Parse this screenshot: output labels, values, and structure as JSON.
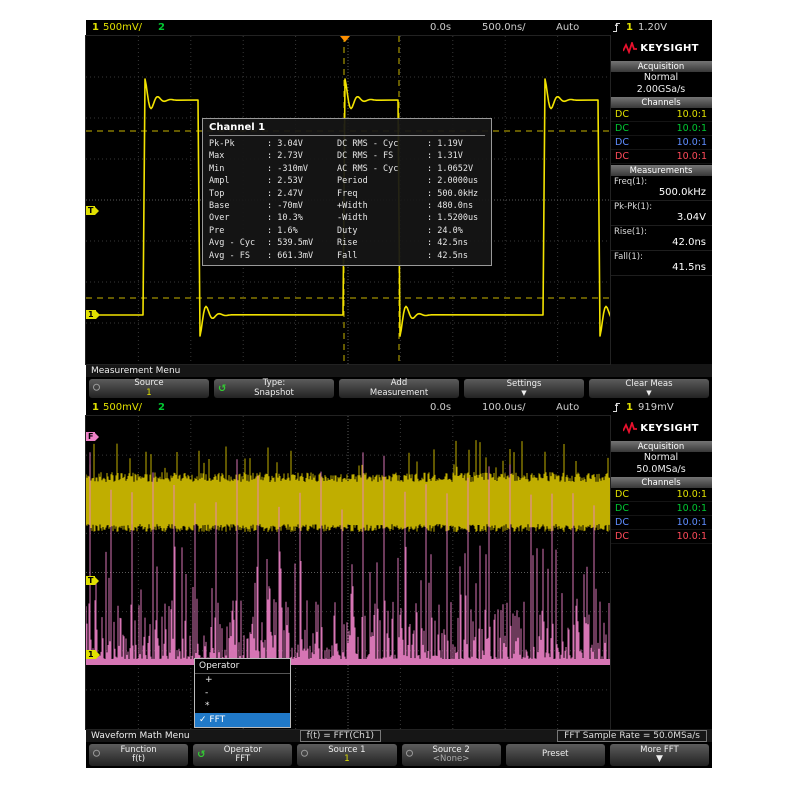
{
  "glyphs": {
    "cycle": "↺",
    "down": "▼",
    "check": "✓"
  },
  "brand": {
    "name": "KEYSIGHT",
    "accent": "#e8112d"
  },
  "scope1": {
    "status": {
      "ch1": "1",
      "ch1_scale": "500mV/",
      "ch2": "2",
      "offset": "0.0s",
      "timebase": "500.0ns/",
      "mode": "Auto",
      "trig_source": "1",
      "trig_level": "1.20V"
    },
    "sidebar": {
      "acq_title": "Acquisition",
      "acq_mode": "Normal",
      "acq_rate": "2.00GSa/s",
      "ch_title": "Channels",
      "channels": [
        {
          "coupling": "DC",
          "probe": "10.0:1",
          "color": "#e0e000"
        },
        {
          "coupling": "DC",
          "probe": "10.0:1",
          "color": "#00c832"
        },
        {
          "coupling": "DC",
          "probe": "10.0:1",
          "color": "#5f8dff"
        },
        {
          "coupling": "DC",
          "probe": "10.0:1",
          "color": "#ff4a5a"
        }
      ],
      "meas_title": "Measurements",
      "measurements": [
        {
          "label": "Freq(1):",
          "value": "500.0kHz"
        },
        {
          "label": "Pk-Pk(1):",
          "value": "3.04V"
        },
        {
          "label": "Rise(1):",
          "value": "42.0ns"
        },
        {
          "label": "Fall(1):",
          "value": "41.5ns"
        }
      ]
    },
    "markers": {
      "trig_level": "T",
      "ground": "1"
    },
    "popup": {
      "title": "Channel 1",
      "rows": [
        {
          "l": "Pk-Pk",
          "lv": ": 3.04V",
          "r": "DC RMS - Cyc",
          "rv": ": 1.19V"
        },
        {
          "l": "Max",
          "lv": ": 2.73V",
          "r": "DC RMS - FS",
          "rv": ": 1.31V"
        },
        {
          "l": "Min",
          "lv": ": -310mV",
          "r": "AC RMS - Cyc",
          "rv": ": 1.0652V"
        },
        {
          "l": "Ampl",
          "lv": ": 2.53V",
          "r": "Period",
          "rv": ": 2.0000us"
        },
        {
          "l": "Top",
          "lv": ": 2.47V",
          "r": "Freq",
          "rv": ": 500.0kHz"
        },
        {
          "l": "Base",
          "lv": ": -70mV",
          "r": "+Width",
          "rv": ": 480.0ns"
        },
        {
          "l": "Over",
          "lv": ": 10.3%",
          "r": "-Width",
          "rv": ": 1.5200us"
        },
        {
          "l": "Pre",
          "lv": ": 1.6%",
          "r": "Duty",
          "rv": ": 24.0%"
        },
        {
          "l": "Avg - Cyc",
          "lv": ": 539.5mV",
          "r": "Rise",
          "rv": ": 42.5ns"
        },
        {
          "l": "Avg - FS",
          "lv": ": 661.3mV",
          "r": "Fall",
          "rv": ": 42.5ns"
        }
      ]
    },
    "menu_label": "Measurement Menu",
    "softkeys": [
      {
        "line1": "Source",
        "line2": "1",
        "icon": "select-circle"
      },
      {
        "line1": "Type:",
        "line2": "Snapshot",
        "icon": "cycle-arrow"
      },
      {
        "line1": "Add",
        "line2": "Measurement",
        "icon": ""
      },
      {
        "line1": "Settings",
        "line2": "",
        "icon": "down-arrow"
      },
      {
        "line1": "Clear Meas",
        "line2": "",
        "icon": "down-arrow"
      }
    ]
  },
  "scope2": {
    "status": {
      "ch1": "1",
      "ch1_scale": "500mV/",
      "ch2": "2",
      "offset": "0.0s",
      "timebase": "100.0us/",
      "mode": "Auto",
      "trig_source": "1",
      "trig_level": "919mV"
    },
    "sidebar": {
      "acq_title": "Acquisition",
      "acq_mode": "Normal",
      "acq_rate": "50.0MSa/s",
      "ch_title": "Channels",
      "channels": [
        {
          "coupling": "DC",
          "probe": "10.0:1",
          "color": "#e0e000"
        },
        {
          "coupling": "DC",
          "probe": "10.0:1",
          "color": "#00c832"
        },
        {
          "coupling": "DC",
          "probe": "10.0:1",
          "color": "#5f8dff"
        },
        {
          "coupling": "DC",
          "probe": "10.0:1",
          "color": "#ff4a5a"
        }
      ]
    },
    "markers": {
      "math": "F",
      "trig_level": "T",
      "ground": "1"
    },
    "dropdown": {
      "title": "Operator",
      "items": [
        "+",
        "-",
        "*"
      ],
      "selected": "FFT"
    },
    "menu_label": "Waveform Math Menu",
    "formula": "f(t) = FFT(Ch1)",
    "sample_rate": "FFT Sample Rate = 50.0MSa/s",
    "softkeys": [
      {
        "line1": "Function",
        "line2": "f(t)",
        "icon": "select-circle"
      },
      {
        "line1": "Operator",
        "line2": "FFT",
        "icon": "cycle-arrow"
      },
      {
        "line1": "Source 1",
        "line2": "1",
        "icon": "select-circle"
      },
      {
        "line1": "Source 2",
        "line2": "<None>",
        "icon": "select-circle"
      },
      {
        "line1": "Preset",
        "line2": "",
        "icon": ""
      },
      {
        "line1": "More FFT",
        "line2": "",
        "icon": "down-arrow"
      }
    ]
  }
}
